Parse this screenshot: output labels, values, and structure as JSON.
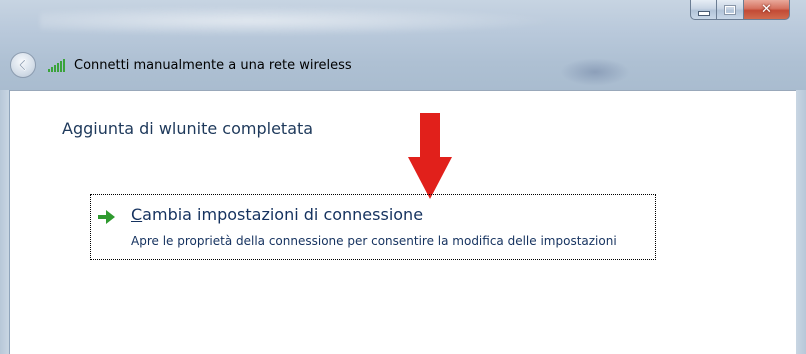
{
  "window": {
    "title": "Connetti manualmente a una rete wireless",
    "controls": {
      "minimize": "minimize",
      "maximize": "maximize",
      "close": "✕"
    }
  },
  "page": {
    "heading": "Aggiunta di wlunite completata"
  },
  "command_link": {
    "title_accel": "C",
    "title_rest": "ambia impostazioni di connessione",
    "description": "Apre le proprietà della connessione per consentire la modifica delle impostazioni"
  },
  "icons": {
    "back": "back-arrow-icon",
    "signal": "wireless-signal-icon",
    "annotation": "red-down-arrow-icon",
    "command": "green-right-arrow-icon"
  },
  "colors": {
    "heading": "#1e395b",
    "link_text": "#15325f",
    "signal_green": "#3aa33a",
    "annotation_red": "#e1201b",
    "command_arrow_green": "#2f9a2f",
    "close_button": "#c24a35"
  }
}
